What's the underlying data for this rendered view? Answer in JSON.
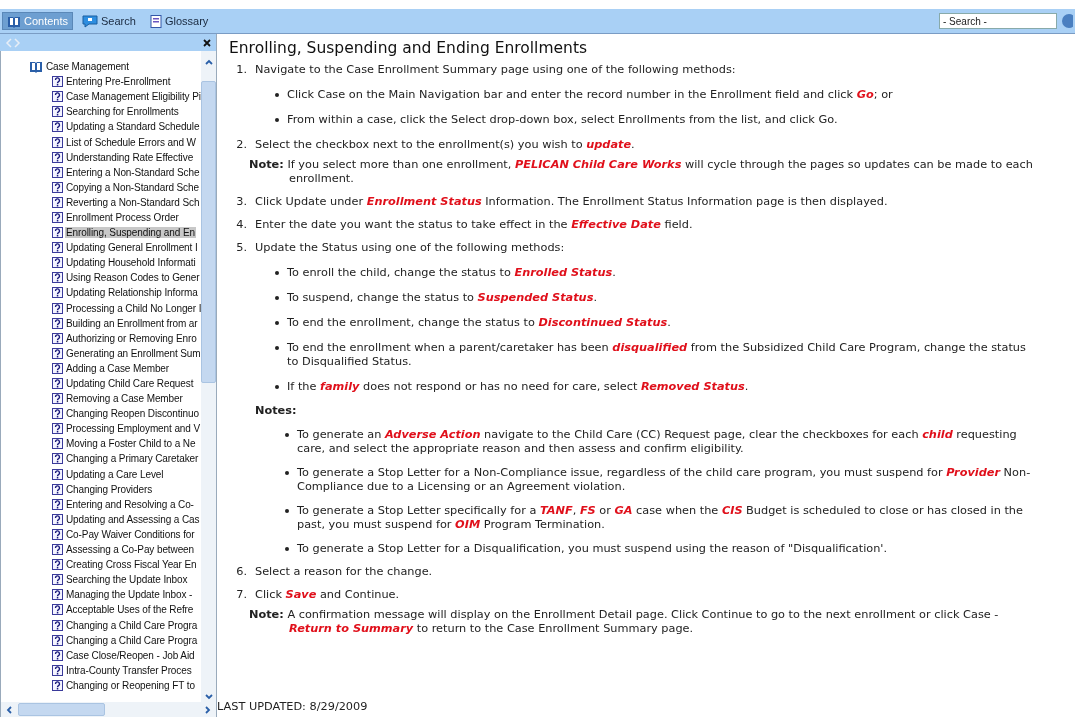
{
  "toolbar": {
    "tabs": [
      {
        "label": "Contents",
        "selected": true
      },
      {
        "label": "Search",
        "selected": false
      },
      {
        "label": "Glossary",
        "selected": false
      }
    ],
    "search": {
      "placeholder": "- Search -"
    }
  },
  "sidebar": {
    "tree": {
      "label": "Case Management",
      "expanded": true,
      "children": [
        {
          "label": "Entering Pre-Enrollment",
          "selected": false
        },
        {
          "label": "Case Management Eligibility Pi",
          "selected": false
        },
        {
          "label": "Searching for Enrollments",
          "selected": false
        },
        {
          "label": "Updating a Standard Schedule",
          "selected": false
        },
        {
          "label": "List of Schedule Errors and W",
          "selected": false
        },
        {
          "label": "Understanding Rate Effective",
          "selected": false
        },
        {
          "label": "Entering a Non-Standard Sche",
          "selected": false
        },
        {
          "label": "Copying a Non-Standard Sche",
          "selected": false
        },
        {
          "label": "Reverting a Non-Standard Sch",
          "selected": false
        },
        {
          "label": "Enrollment Process Order",
          "selected": false
        },
        {
          "label": "Enrolling, Suspending and En",
          "selected": true
        },
        {
          "label": "Updating General Enrollment I",
          "selected": false
        },
        {
          "label": "Updating Household Informati",
          "selected": false
        },
        {
          "label": "Using Reason Codes to Gener",
          "selected": false
        },
        {
          "label": "Updating Relationship Informa",
          "selected": false
        },
        {
          "label": "Processing a Child No Longer I",
          "selected": false
        },
        {
          "label": "Building an Enrollment from ar",
          "selected": false
        },
        {
          "label": "Authorizing or Removing Enro",
          "selected": false
        },
        {
          "label": "Generating an Enrollment Sum",
          "selected": false
        },
        {
          "label": "Adding a Case Member",
          "selected": false
        },
        {
          "label": "Updating Child Care Request",
          "selected": false
        },
        {
          "label": "Removing a Case Member",
          "selected": false
        },
        {
          "label": "Changing Reopen Discontinuo",
          "selected": false
        },
        {
          "label": "Processing Employment and V",
          "selected": false
        },
        {
          "label": "Moving a Foster Child to a Ne",
          "selected": false
        },
        {
          "label": "Changing a Primary Caretaker",
          "selected": false
        },
        {
          "label": "Updating a Care Level",
          "selected": false
        },
        {
          "label": "Changing Providers",
          "selected": false
        },
        {
          "label": "Entering and Resolving a Co-",
          "selected": false
        },
        {
          "label": "Updating and Assessing a Cas",
          "selected": false
        },
        {
          "label": "Co-Pay Waiver Conditions for",
          "selected": false
        },
        {
          "label": "Assessing a Co-Pay between",
          "selected": false
        },
        {
          "label": "Creating Cross Fiscal Year En",
          "selected": false
        },
        {
          "label": "Searching the Update Inbox",
          "selected": false
        },
        {
          "label": "Managing the Update Inbox -",
          "selected": false
        },
        {
          "label": "Acceptable Uses of the Refre",
          "selected": false
        },
        {
          "label": "Changing a Child Care Progra",
          "selected": false
        },
        {
          "label": "Changing a Child Care Progra",
          "selected": false
        },
        {
          "label": "Case Close/Reopen - Job Aid",
          "selected": false
        },
        {
          "label": "Intra-County Transfer Proces",
          "selected": false
        },
        {
          "label": "Changing or Reopening FT to",
          "selected": false
        }
      ]
    }
  },
  "article": {
    "title": "Enrolling, Suspending and Ending Enrollments",
    "steps": [
      {
        "number": "1.",
        "text": "Navigate to the Case Enrollment Summary page using one of the following methods:",
        "bullets": [
          "Click Case on the Main Navigation bar and enter the record number in the Enrollment field and click **Go**; or",
          "From within a case, click the Select drop-down box, select Enrollments from the list, and click Go."
        ]
      },
      {
        "number": "2.",
        "text": "Select the checkbox next to the enrollment(s) you wish to **update**.",
        "note": {
          "label": "Note:",
          "text": "If you select more than one enrollment, **PELICAN Child Care Works** will cycle through the pages so updates can be made to each enrollment."
        }
      },
      {
        "number": "3.",
        "text": "Click Update under **Enrollment Status** Information. The Enrollment Status Information page is then displayed."
      },
      {
        "number": "4.",
        "text": "Enter the date you want the status to take effect in the **Effective Date** field."
      },
      {
        "number": "5.",
        "text": "Update the Status using one of the following methods:",
        "bullets": [
          "To enroll the child, change the status to **Enrolled Status**.",
          "To suspend, change the status to **Suspended Status**.",
          "To end the enrollment, change the status to **Discontinued Status**.",
          "To end the enrollment when a parent/caretaker has been **disqualified** from the Subsidized Child Care Program, change the status to Disqualified Status.",
          "If the **family** does not respond or has no need for care, select **Removed Status**."
        ],
        "notes": {
          "label": "Notes:",
          "items": [
            "To generate an **Adverse Action** navigate to the Child Care (CC) Request page, clear the checkboxes for each **child** requesting care, and select the appropriate reason and then assess and confirm eligibility.",
            "To generate a Stop Letter for a Non-Compliance issue, regardless of the child care program, you must suspend for **Provider** Non-Compliance due to a Licensing or an Agreement violation.",
            "To generate a Stop Letter specifically for a **TANF**, **FS** or **GA** case when the **CIS** Budget is scheduled to close or has closed in the past, you must suspend for **OIM** Program Termination.",
            "To generate a Stop Letter for a Disqualification, you must suspend using the reason of \"Disqualification'."
          ]
        }
      },
      {
        "number": "6.",
        "text": "Select a reason for the change."
      },
      {
        "number": "7.",
        "text": "Click **Save** and Continue.",
        "note": {
          "label": "Note:",
          "text": "A confirmation message will display on the Enrollment Detail page. Click Continue to go to the next enrollment or click Case - **Return to Summary** to return to the Case Enrollment Summary page."
        }
      }
    ],
    "footer": "LAST UPDATED: 8/29/2009"
  }
}
